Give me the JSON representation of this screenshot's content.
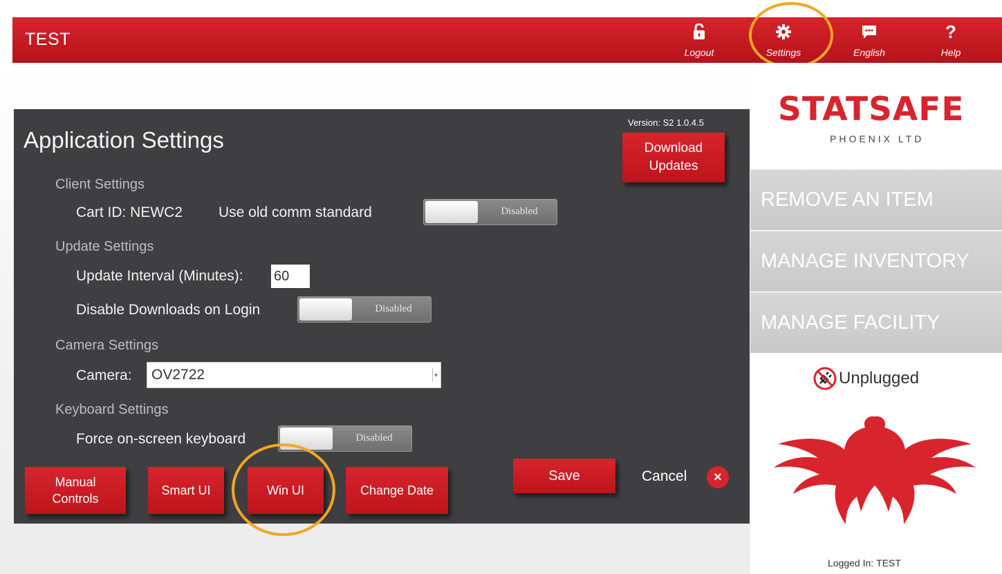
{
  "header": {
    "title": "TEST",
    "logout_label": "Logout",
    "settings_label": "Settings",
    "language_label": "English",
    "help_label": "Help"
  },
  "dialog": {
    "title": "Application Settings",
    "version": "Version: S2 1.0.4.5",
    "download_label": "Download\nUpdates",
    "client": {
      "section": "Client Settings",
      "cart_id": "Cart ID: NEWC2",
      "old_comm_label": "Use old comm standard",
      "old_comm_state": "Disabled"
    },
    "update": {
      "section": "Update Settings",
      "interval_label": "Update Interval (Minutes):",
      "interval_value": "60",
      "disable_dl_label": "Disable Downloads on Login",
      "disable_dl_state": "Disabled"
    },
    "camera": {
      "section": "Camera Settings",
      "label": "Camera:",
      "selected": "OV2722"
    },
    "keyboard": {
      "section": "Keyboard Settings",
      "force_label": "Force on-screen keyboard",
      "force_state": "Disabled"
    },
    "buttons": {
      "manual": "Manual\nControls",
      "smart": "Smart UI",
      "win": "Win UI",
      "change_date": "Change Date",
      "save": "Save",
      "cancel": "Cancel"
    }
  },
  "sidebar": {
    "logo": "STATSAFE",
    "logo_sub": "PHOENIX LTD",
    "menu": [
      "REMOVE AN ITEM",
      "MANAGE INVENTORY",
      "MANAGE FACILITY"
    ],
    "status": "Unplugged",
    "logged_in_label": "Logged In:",
    "logged_in_user": "TEST"
  },
  "colors": {
    "accent": "#d8242c",
    "highlight_ring": "#f5a623",
    "dialog_bg": "#3f3f41"
  }
}
